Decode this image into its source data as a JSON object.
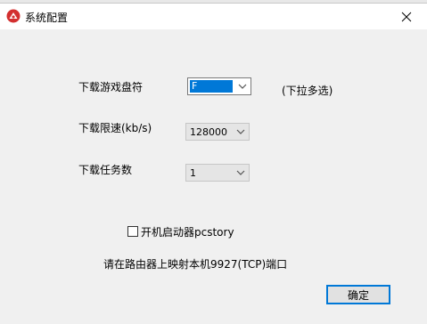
{
  "window": {
    "title": "系统配置"
  },
  "form": {
    "drive_label": "下载游戏盘符",
    "drive_value": "F",
    "drive_hint": "(下拉多选)",
    "speed_label": "下载限速(kb/s)",
    "speed_value": "128000",
    "task_label": "下载任务数",
    "task_value": "1",
    "autostart_label": "开机启动器pcstory",
    "autostart_checked": false,
    "port_note": "请在路由器上映射本机9927(TCP)端口"
  },
  "buttons": {
    "ok_label": "确定"
  },
  "colors": {
    "accent": "#0078d7",
    "icon_red": "#d32f2f"
  }
}
